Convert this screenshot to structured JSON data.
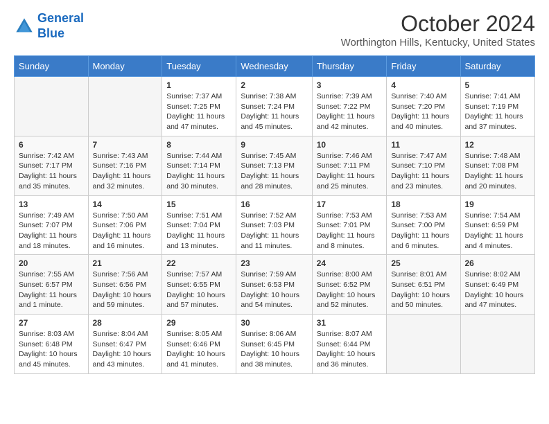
{
  "logo": {
    "line1": "General",
    "line2": "Blue"
  },
  "title": "October 2024",
  "location": "Worthington Hills, Kentucky, United States",
  "weekdays": [
    "Sunday",
    "Monday",
    "Tuesday",
    "Wednesday",
    "Thursday",
    "Friday",
    "Saturday"
  ],
  "weeks": [
    [
      {
        "day": "",
        "info": ""
      },
      {
        "day": "",
        "info": ""
      },
      {
        "day": "1",
        "info": "Sunrise: 7:37 AM\nSunset: 7:25 PM\nDaylight: 11 hours and 47 minutes."
      },
      {
        "day": "2",
        "info": "Sunrise: 7:38 AM\nSunset: 7:24 PM\nDaylight: 11 hours and 45 minutes."
      },
      {
        "day": "3",
        "info": "Sunrise: 7:39 AM\nSunset: 7:22 PM\nDaylight: 11 hours and 42 minutes."
      },
      {
        "day": "4",
        "info": "Sunrise: 7:40 AM\nSunset: 7:20 PM\nDaylight: 11 hours and 40 minutes."
      },
      {
        "day": "5",
        "info": "Sunrise: 7:41 AM\nSunset: 7:19 PM\nDaylight: 11 hours and 37 minutes."
      }
    ],
    [
      {
        "day": "6",
        "info": "Sunrise: 7:42 AM\nSunset: 7:17 PM\nDaylight: 11 hours and 35 minutes."
      },
      {
        "day": "7",
        "info": "Sunrise: 7:43 AM\nSunset: 7:16 PM\nDaylight: 11 hours and 32 minutes."
      },
      {
        "day": "8",
        "info": "Sunrise: 7:44 AM\nSunset: 7:14 PM\nDaylight: 11 hours and 30 minutes."
      },
      {
        "day": "9",
        "info": "Sunrise: 7:45 AM\nSunset: 7:13 PM\nDaylight: 11 hours and 28 minutes."
      },
      {
        "day": "10",
        "info": "Sunrise: 7:46 AM\nSunset: 7:11 PM\nDaylight: 11 hours and 25 minutes."
      },
      {
        "day": "11",
        "info": "Sunrise: 7:47 AM\nSunset: 7:10 PM\nDaylight: 11 hours and 23 minutes."
      },
      {
        "day": "12",
        "info": "Sunrise: 7:48 AM\nSunset: 7:08 PM\nDaylight: 11 hours and 20 minutes."
      }
    ],
    [
      {
        "day": "13",
        "info": "Sunrise: 7:49 AM\nSunset: 7:07 PM\nDaylight: 11 hours and 18 minutes."
      },
      {
        "day": "14",
        "info": "Sunrise: 7:50 AM\nSunset: 7:06 PM\nDaylight: 11 hours and 16 minutes."
      },
      {
        "day": "15",
        "info": "Sunrise: 7:51 AM\nSunset: 7:04 PM\nDaylight: 11 hours and 13 minutes."
      },
      {
        "day": "16",
        "info": "Sunrise: 7:52 AM\nSunset: 7:03 PM\nDaylight: 11 hours and 11 minutes."
      },
      {
        "day": "17",
        "info": "Sunrise: 7:53 AM\nSunset: 7:01 PM\nDaylight: 11 hours and 8 minutes."
      },
      {
        "day": "18",
        "info": "Sunrise: 7:53 AM\nSunset: 7:00 PM\nDaylight: 11 hours and 6 minutes."
      },
      {
        "day": "19",
        "info": "Sunrise: 7:54 AM\nSunset: 6:59 PM\nDaylight: 11 hours and 4 minutes."
      }
    ],
    [
      {
        "day": "20",
        "info": "Sunrise: 7:55 AM\nSunset: 6:57 PM\nDaylight: 11 hours and 1 minute."
      },
      {
        "day": "21",
        "info": "Sunrise: 7:56 AM\nSunset: 6:56 PM\nDaylight: 10 hours and 59 minutes."
      },
      {
        "day": "22",
        "info": "Sunrise: 7:57 AM\nSunset: 6:55 PM\nDaylight: 10 hours and 57 minutes."
      },
      {
        "day": "23",
        "info": "Sunrise: 7:59 AM\nSunset: 6:53 PM\nDaylight: 10 hours and 54 minutes."
      },
      {
        "day": "24",
        "info": "Sunrise: 8:00 AM\nSunset: 6:52 PM\nDaylight: 10 hours and 52 minutes."
      },
      {
        "day": "25",
        "info": "Sunrise: 8:01 AM\nSunset: 6:51 PM\nDaylight: 10 hours and 50 minutes."
      },
      {
        "day": "26",
        "info": "Sunrise: 8:02 AM\nSunset: 6:49 PM\nDaylight: 10 hours and 47 minutes."
      }
    ],
    [
      {
        "day": "27",
        "info": "Sunrise: 8:03 AM\nSunset: 6:48 PM\nDaylight: 10 hours and 45 minutes."
      },
      {
        "day": "28",
        "info": "Sunrise: 8:04 AM\nSunset: 6:47 PM\nDaylight: 10 hours and 43 minutes."
      },
      {
        "day": "29",
        "info": "Sunrise: 8:05 AM\nSunset: 6:46 PM\nDaylight: 10 hours and 41 minutes."
      },
      {
        "day": "30",
        "info": "Sunrise: 8:06 AM\nSunset: 6:45 PM\nDaylight: 10 hours and 38 minutes."
      },
      {
        "day": "31",
        "info": "Sunrise: 8:07 AM\nSunset: 6:44 PM\nDaylight: 10 hours and 36 minutes."
      },
      {
        "day": "",
        "info": ""
      },
      {
        "day": "",
        "info": ""
      }
    ]
  ]
}
